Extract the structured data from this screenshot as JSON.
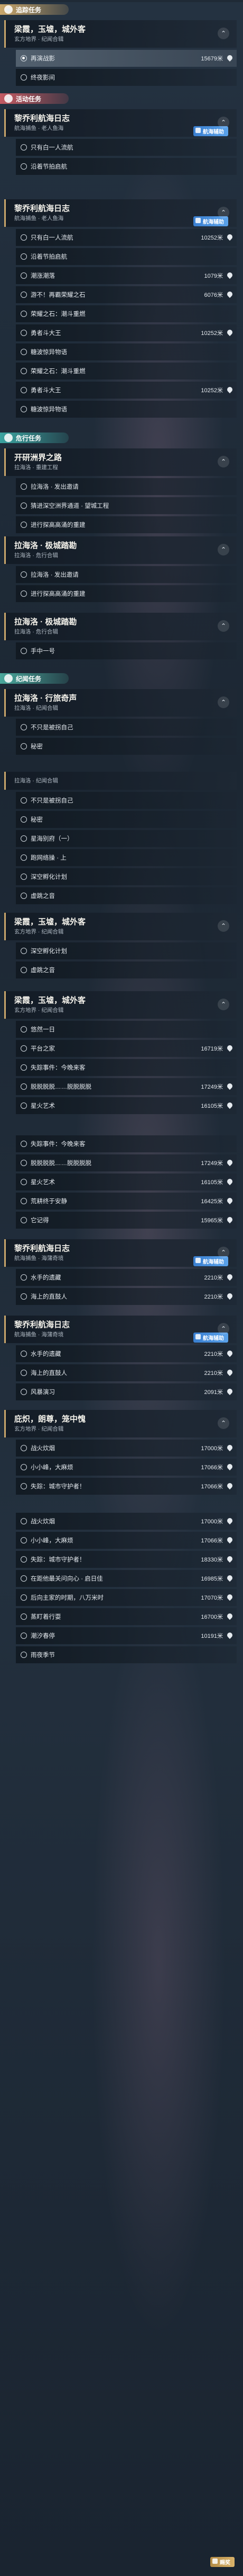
{
  "sections": {
    "tracked": {
      "label": "追踪任务",
      "icon": "◆",
      "color": "#c9a66b"
    },
    "events": {
      "label": "活动任务",
      "icon": "★",
      "color": "#c55a62"
    },
    "danger": {
      "label": "危行任务",
      "icon": "⚔",
      "color": "#3ba4a0"
    },
    "records": {
      "label": "纪闻任务",
      "icon": "✦",
      "color": "#4aa89c"
    }
  },
  "badges": {
    "blue": "航海辅助",
    "gold": "赐奖",
    "gold2": "糖波惊异物语"
  },
  "cards": [
    {
      "title": "梁霞，玉墟，城外客",
      "sub": "玄方地界 · 纪闻合辑",
      "tasks": [
        {
          "label": "再演战影",
          "dist": "15679米",
          "active": true
        },
        {
          "label": "终夜影间",
          "dist": ""
        }
      ]
    },
    {
      "title": "黎乔利航海日志",
      "sub": "航海捕鱼 · 老人鱼海",
      "tasks": [
        {
          "label": "只有白一人流航",
          "dist": ""
        },
        {
          "label": "沿着节拍启航",
          "dist": ""
        }
      ]
    },
    {
      "title": "黎乔利航海日志",
      "sub": "航海捕鱼 · 老人鱼海",
      "tasks": [
        {
          "label": "只有白一人流航",
          "dist": "10252米"
        },
        {
          "label": "沿着节拍启航",
          "dist": ""
        },
        {
          "label": "潮涨潮落",
          "dist": "1079米"
        },
        {
          "label": "游不！再霸荣耀之石",
          "dist": "6076米"
        },
        {
          "label": "荣耀之石：潮斗重燃",
          "dist": ""
        },
        {
          "label": "勇者斗大王",
          "dist": "10252米"
        },
        {
          "label": "糖波惊异物语",
          "dist": ""
        },
        {
          "label": "荣耀之石：潮斗重燃",
          "dist": ""
        },
        {
          "label": "勇者斗大王",
          "dist": "10252米"
        },
        {
          "label": "糖波惊异物语",
          "dist": ""
        }
      ]
    },
    {
      "title": "开研洲界之路",
      "sub": "拉海洛 · 重建工程",
      "tasks": [
        {
          "label": "拉海洛 · 发出邀请",
          "dist": ""
        },
        {
          "label": "猜进深空洲界通道 · 望城工程",
          "dist": ""
        },
        {
          "label": "进行探高高涌的重建",
          "dist": ""
        }
      ]
    },
    {
      "title": "拉海洛 · 极城踏勘",
      "sub": "拉海洛 · 危行合辑",
      "tasks": [
        {
          "label": "拉海洛 · 发出邀请",
          "dist": ""
        },
        {
          "label": "进行探高高涌的重建",
          "dist": ""
        }
      ]
    },
    {
      "title": "拉海洛 · 极城踏勘",
      "sub": "拉海洛 · 危行合辑",
      "tasks": [
        {
          "label": "手中一号",
          "dist": ""
        }
      ]
    },
    {
      "title": "拉海洛 · 行旅奇声",
      "sub": "拉海洛 · 纪闻合辑",
      "tasks": [
        {
          "label": "不只是被拐自己",
          "dist": ""
        },
        {
          "label": "秘密",
          "dist": ""
        }
      ]
    },
    {
      "title": "",
      "sub": "拉海洛 · 纪闻合辑",
      "tasks": [
        {
          "label": "不只是被拐自己",
          "dist": ""
        },
        {
          "label": "秘密",
          "dist": ""
        },
        {
          "label": "星海别府（一）",
          "dist": ""
        },
        {
          "label": "跑网络操 · 上",
          "dist": ""
        },
        {
          "label": "深空孵化计划",
          "dist": ""
        },
        {
          "label": "虚跳之音",
          "dist": ""
        }
      ]
    },
    {
      "title": "梁霞，玉墟，城外客",
      "sub": "玄方地界 · 纪闻合辑",
      "tasks": [
        {
          "label": "深空孵化计划",
          "dist": ""
        },
        {
          "label": "虚跳之音",
          "dist": ""
        }
      ]
    },
    {
      "title": "梁霞，玉墟，城外客",
      "sub": "玄方地界 · 纪闻合辑",
      "tasks": [
        {
          "label": "悠然一日",
          "dist": ""
        },
        {
          "label": "平台之家",
          "dist": "16719米"
        },
        {
          "label": "失踪事件：今晚来客",
          "dist": ""
        },
        {
          "label": "脱脱脱脱……脱脱脱脱",
          "dist": "17249米"
        },
        {
          "label": "星火艺术",
          "dist": "16105米"
        }
      ]
    },
    {
      "title": "",
      "sub": "",
      "tasks": [
        {
          "label": "失踪事件：今晚来客",
          "dist": ""
        },
        {
          "label": "脱脱脱脱……脱脱脱脱",
          "dist": "17249米"
        },
        {
          "label": "星火艺术",
          "dist": "16105米"
        },
        {
          "label": "荒耕终于安静",
          "dist": "16425米"
        },
        {
          "label": "它记得",
          "dist": "15965米"
        }
      ]
    },
    {
      "title": "黎乔利航海日志",
      "sub": "航海捕鱼 · 海蒲奇境",
      "tasks": [
        {
          "label": "水手的遗藏",
          "dist": "2210米"
        },
        {
          "label": "海上的直鼓人",
          "dist": "2210米"
        }
      ]
    },
    {
      "title": "黎乔利航海日志",
      "sub": "航海捕鱼 · 海蒲奇境",
      "tasks": [
        {
          "label": "水手的遗藏",
          "dist": "2210米"
        },
        {
          "label": "海上的直鼓人",
          "dist": "2210米"
        },
        {
          "label": "风暴演习",
          "dist": "2091米"
        }
      ]
    },
    {
      "title": "庇炽，朗尊，笼中愧",
      "sub": "玄方地界 · 纪闻合辑",
      "tasks": [
        {
          "label": "战火炊烟",
          "dist": "17000米"
        },
        {
          "label": "小小峰，大麻烦",
          "dist": "17066米"
        },
        {
          "label": "失踪：城市守护者！",
          "dist": "17066米"
        }
      ]
    },
    {
      "title": "",
      "sub": "",
      "tasks": [
        {
          "label": "战火炊烟",
          "dist": "17000米"
        },
        {
          "label": "小小峰，大麻烦",
          "dist": "17066米"
        },
        {
          "label": "失踪：城市守护者！",
          "dist": "18330米"
        },
        {
          "label": "在距他最关问向心 · 启日佳",
          "dist": "16985米"
        },
        {
          "label": "后向主家的时期，八万米时",
          "dist": "17070米"
        },
        {
          "label": "蒸盯着行耍",
          "dist": "16700米"
        },
        {
          "label": "潮汐春停",
          "dist": "10191米"
        },
        {
          "label": "雨夜季节",
          "dist": ""
        }
      ]
    }
  ]
}
